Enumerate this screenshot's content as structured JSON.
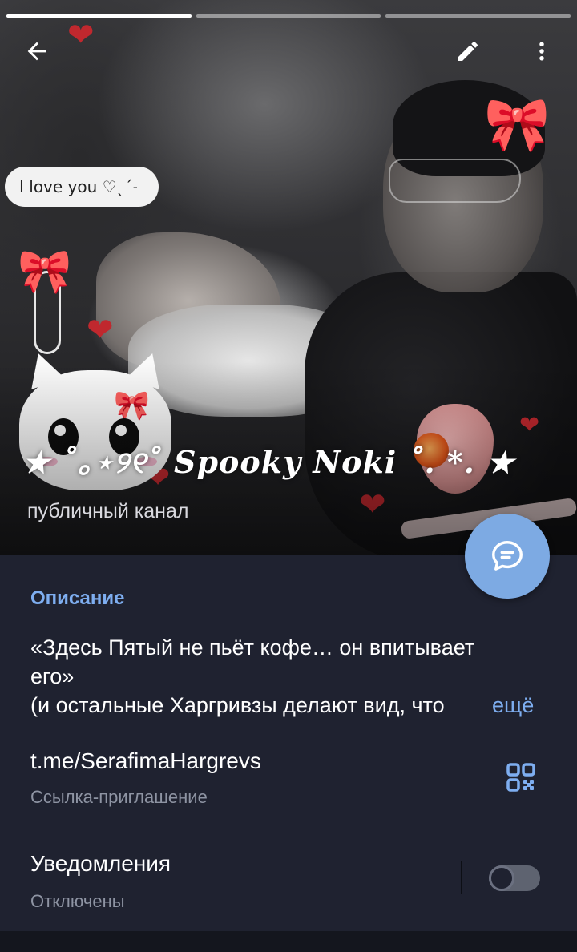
{
  "header": {
    "story_progress": {
      "segments": 3,
      "active": 1
    },
    "channel_title": "★ ˚｡⋆୨୧˚ Spooky Noki ˚. *. ★",
    "channel_type": "публичный канал",
    "sticker_text": "I love you ♡ˎˊ˗"
  },
  "description": {
    "heading": "Описание",
    "line1": "«Здесь Пятый не пьёт кофе… он впитывает",
    "line2": "его»",
    "line3": "(и остальные Харгривзы делают вид, что",
    "more_label": "ещё"
  },
  "link": {
    "url": "t.me/SerafimaHargrevs",
    "caption": "Ссылка-приглашение"
  },
  "notifications": {
    "label": "Уведомления",
    "status": "Отключены",
    "enabled": false
  },
  "colors": {
    "accent": "#7eaef0",
    "fab": "#7daae3",
    "panel": "#1f2230",
    "secondary_text": "#8e94a3"
  },
  "icons": {
    "back": "back-arrow-icon",
    "edit": "pencil-icon",
    "more": "more-vertical-icon",
    "fab": "chat-bubble-icon",
    "qr": "qr-code-icon"
  }
}
